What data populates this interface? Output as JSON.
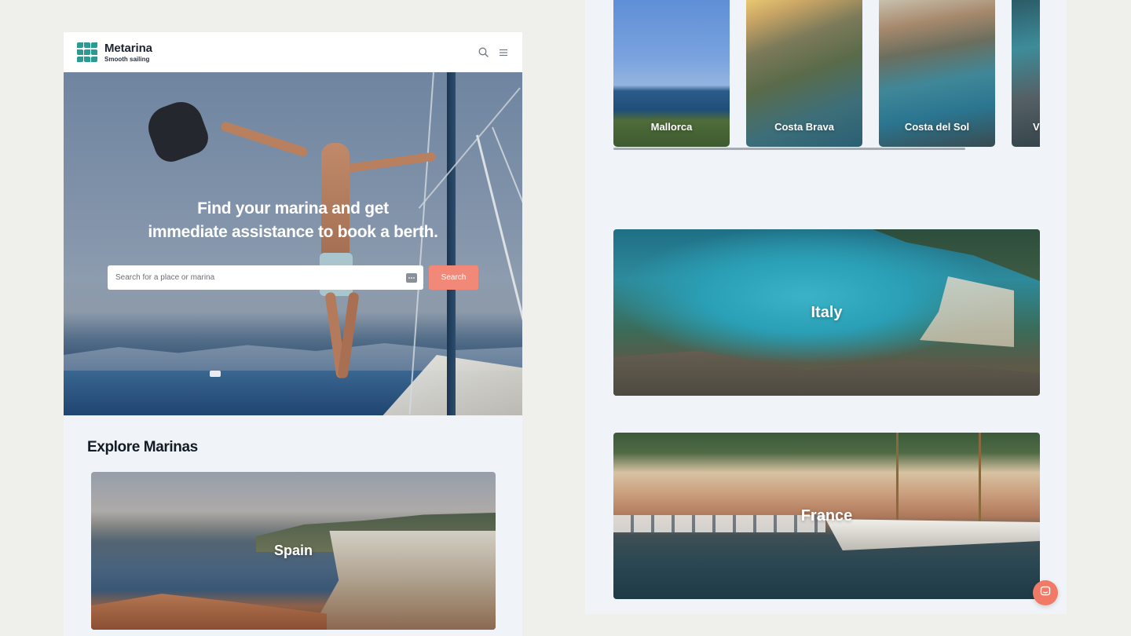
{
  "brand": {
    "name": "Metarina",
    "tagline": "Smooth sailing"
  },
  "hero": {
    "title_line1": "Find your marina and get",
    "title_line2": "immediate assistance to book a berth.",
    "search_placeholder": "Search for a place or marina",
    "search_button": "Search"
  },
  "explore": {
    "title": "Explore Marinas",
    "featured_country": "Spain"
  },
  "regions": [
    {
      "label": "Mallorca"
    },
    {
      "label": "Costa Brava"
    },
    {
      "label": "Costa del Sol"
    },
    {
      "label": "V"
    }
  ],
  "countries": [
    {
      "label": "Italy"
    },
    {
      "label": "France"
    }
  ],
  "colors": {
    "brand_teal": "#2a9a92",
    "accent_coral": "#f28878",
    "panel_bg": "#f0f3f7",
    "page_bg": "#efefeb"
  },
  "icons": {
    "search": "search-icon",
    "menu": "menu-icon",
    "keyboard": "keyboard-icon",
    "chat": "chat-icon"
  }
}
